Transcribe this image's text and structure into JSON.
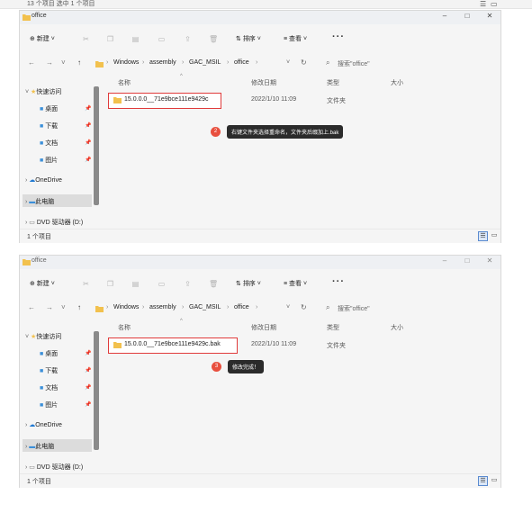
{
  "top_strip": {
    "text": "13 个项目    选中 1 个项目"
  },
  "windows": [
    {
      "title": "office",
      "toolbar": {
        "new_label": "新建",
        "sort_label": "排序",
        "view_label": "查看",
        "more_label": "···"
      },
      "address": {
        "segments": [
          "Windows",
          "assembly",
          "GAC_MSIL",
          "office"
        ],
        "search_placeholder": "搜索\"office\""
      },
      "sidebar": {
        "quick_access": "快速访问",
        "desktop": "桌面",
        "downloads": "下载",
        "documents": "文档",
        "pictures": "图片",
        "onedrive": "OneDrive",
        "this_pc": "此电脑",
        "dvd": "DVD 驱动器 (D:)"
      },
      "columns": {
        "name": "名称",
        "date": "修改日期",
        "type": "类型",
        "size": "大小"
      },
      "row": {
        "name": "15.0.0.0__71e9bce111e9429c",
        "date": "2022/1/10 11:09",
        "type": "文件夹"
      },
      "step": {
        "number": "2",
        "note": "右键文件夹选择重命名，文件夹后缀加上.bak"
      },
      "status": "1 个项目"
    },
    {
      "title": "office",
      "toolbar": {
        "new_label": "新建",
        "sort_label": "排序",
        "view_label": "查看",
        "more_label": "···"
      },
      "address": {
        "segments": [
          "Windows",
          "assembly",
          "GAC_MSIL",
          "office"
        ],
        "search_placeholder": "搜索\"office\""
      },
      "sidebar": {
        "quick_access": "快速访问",
        "desktop": "桌面",
        "downloads": "下载",
        "documents": "文档",
        "pictures": "图片",
        "onedrive": "OneDrive",
        "this_pc": "此电脑",
        "dvd": "DVD 驱动器 (D:)"
      },
      "columns": {
        "name": "名称",
        "date": "修改日期",
        "type": "类型",
        "size": "大小"
      },
      "row": {
        "name": "15.0.0.0__71e9bce111e9429c.bak",
        "date": "2022/1/10 11:09",
        "type": "文件夹"
      },
      "step": {
        "number": "3",
        "note": "修改完成！"
      },
      "status": "1 个项目"
    }
  ],
  "colors": {
    "folder": "#f2c14e",
    "highlight": "#e03b3b",
    "badge": "#e84f3e",
    "onedrive": "#1f78d1"
  }
}
